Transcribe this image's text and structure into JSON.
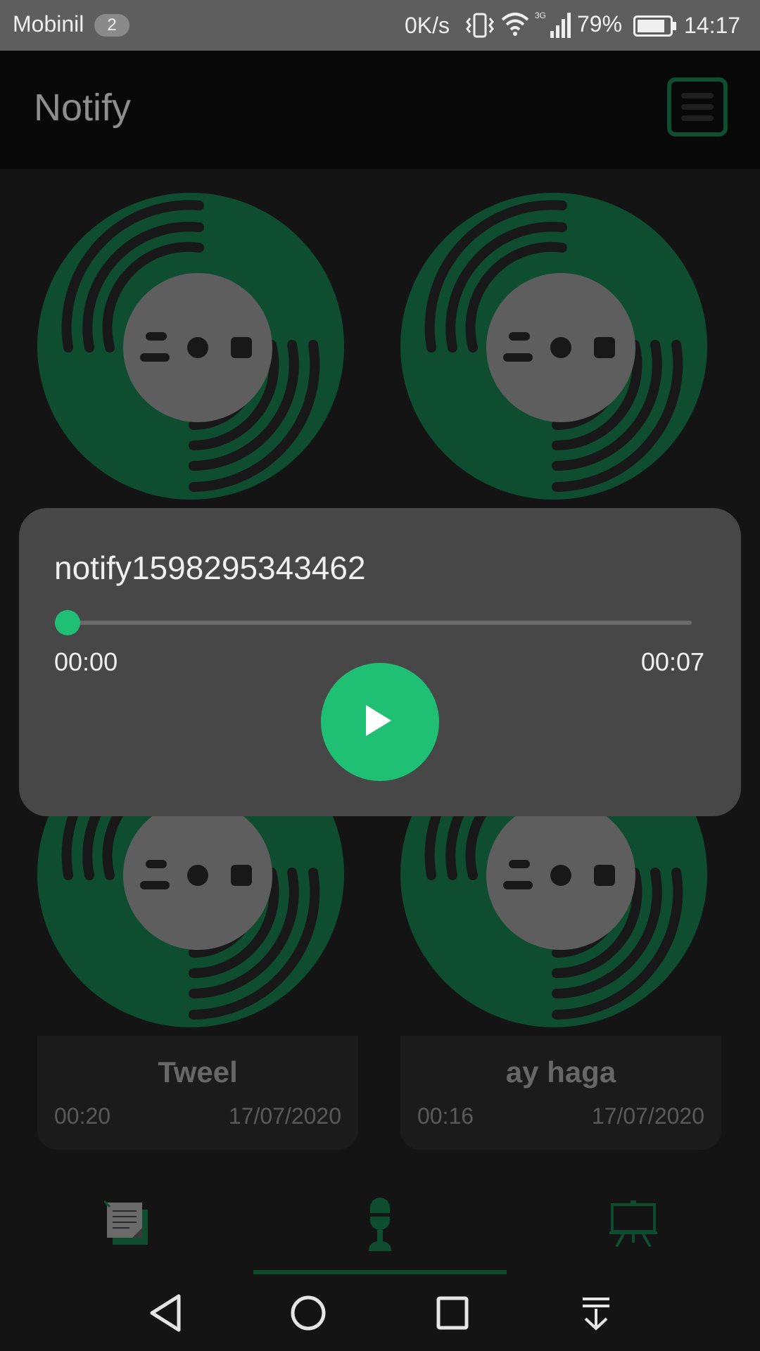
{
  "status_bar": {
    "carrier": "Mobinil",
    "notification_count": "2",
    "net_speed": "0K/s",
    "network_type": "3G",
    "battery_percent": "79%",
    "time": "14:17"
  },
  "app_bar": {
    "title": "Notify",
    "menu_icon": "hamburger-menu-icon"
  },
  "recordings": [
    {
      "title": "",
      "duration": "",
      "date": ""
    },
    {
      "title": "",
      "duration": "",
      "date": ""
    },
    {
      "title": "Tweel",
      "duration": "00:20",
      "date": "17/07/2020"
    },
    {
      "title": "ay haga",
      "duration": "00:16",
      "date": "17/07/2020"
    }
  ],
  "player": {
    "file_name": "notify1598295343462",
    "current_time": "00:00",
    "total_time": "00:07",
    "progress": 0
  },
  "tabs": [
    {
      "icon": "notes-icon",
      "active": false
    },
    {
      "icon": "microphone-icon",
      "active": true
    },
    {
      "icon": "presentation-board-icon",
      "active": false
    }
  ],
  "nav_bar": [
    "back-icon",
    "home-icon",
    "recents-icon",
    "notification-shade-icon"
  ],
  "colors": {
    "accent": "#20c074",
    "dark_green": "#0e4d2f",
    "background": "#141414",
    "dialog": "#474747"
  }
}
